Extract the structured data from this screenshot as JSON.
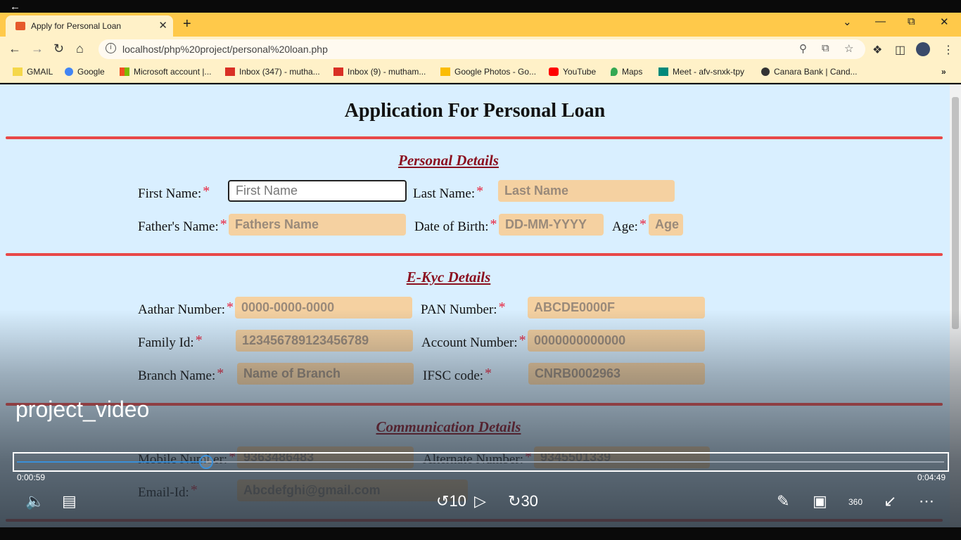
{
  "browser": {
    "tab_title": "Apply for Personal Loan",
    "url": "localhost/php%20project/personal%20loan.php",
    "bookmarks": [
      {
        "label": "GMAIL",
        "color": "#f5d74a"
      },
      {
        "label": "Google",
        "color": "#4285f4"
      },
      {
        "label": "Microsoft account |...",
        "color": "#f25022"
      },
      {
        "label": "Inbox (347) - mutha...",
        "color": "#d93025"
      },
      {
        "label": "Inbox (9) - mutham...",
        "color": "#d93025"
      },
      {
        "label": "Google Photos - Go...",
        "color": "#fbbc04"
      },
      {
        "label": "YouTube",
        "color": "#ff0000"
      },
      {
        "label": "Maps",
        "color": "#34a853"
      },
      {
        "label": "Meet - afv-snxk-tpy",
        "color": "#00897b"
      },
      {
        "label": "Canara Bank | Cand...",
        "color": "#333333"
      }
    ]
  },
  "form": {
    "title": "Application For Personal Loan",
    "personal": {
      "heading": "Personal Details",
      "first_name_label": "First Name:",
      "first_name_placeholder": "First Name",
      "last_name_label": "Last Name:",
      "last_name_placeholder": "Last Name",
      "father_label": "Father's Name:",
      "father_placeholder": "Fathers Name",
      "dob_label": "Date of Birth:",
      "dob_placeholder": "DD-MM-YYYY",
      "age_label": "Age:",
      "age_placeholder": "Age"
    },
    "ekyc": {
      "heading": "E-Kyc Details",
      "aadhar_label": "Aathar Number:",
      "aadhar_placeholder": "0000-0000-0000",
      "pan_label": "PAN Number:",
      "pan_placeholder": "ABCDE0000F",
      "family_label": "Family Id:",
      "family_placeholder": "123456789123456789",
      "account_label": "Account Number:",
      "account_placeholder": "0000000000000",
      "branch_label": "Branch Name:",
      "branch_placeholder": "Name of Branch",
      "ifsc_label": "IFSC code:",
      "ifsc_placeholder": "CNRB0002963"
    },
    "communication": {
      "heading": "Communication Details",
      "mobile_label": "Mobile Number:",
      "mobile_placeholder": "9363486483",
      "alternate_label": "Alternate Number:",
      "alternate_placeholder": "9345501339",
      "email_label": "Email-Id:",
      "email_placeholder": "Abcdefghi@gmail.com"
    },
    "required_mark": "*"
  },
  "player": {
    "video_title": "project_video",
    "current_time": "0:00:59",
    "total_time": "0:04:49",
    "progress_fraction": 0.204,
    "rewind_seconds": "10",
    "forward_seconds": "30",
    "view_360_label": "360"
  }
}
